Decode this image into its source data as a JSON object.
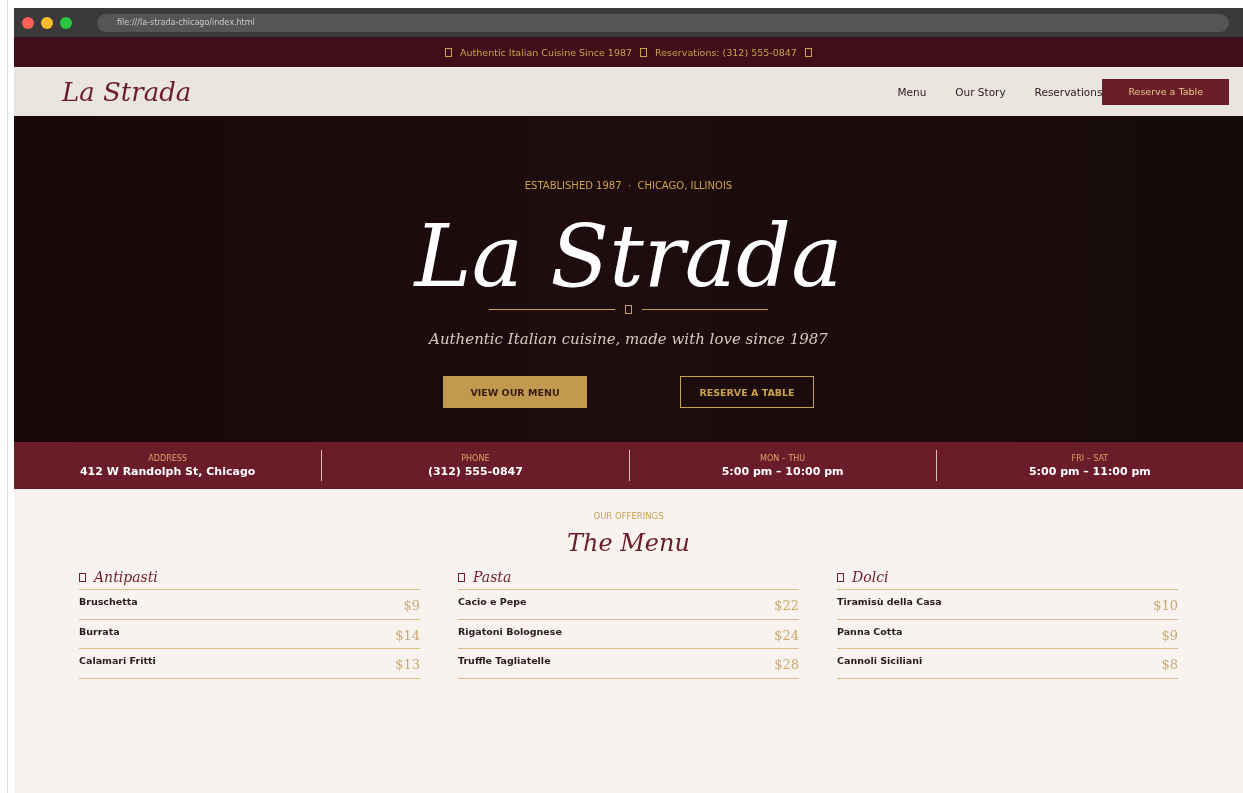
{
  "browser": {
    "url": "file:///la-strada-chicago/index.html"
  },
  "announcement": {
    "items": [
      "Authentic Italian Cuisine Since 1987",
      "Reservations: (312) 555-0847"
    ]
  },
  "nav": {
    "logo": "La Strada",
    "links": [
      "Menu",
      "Our Story",
      "Reservations"
    ],
    "cta": "Reserve a Table"
  },
  "hero": {
    "eyebrow": "ESTABLISHED 1987  ·  CHICAGO, ILLINOIS",
    "title": "La Strada",
    "tagline": "Authentic Italian cuisine, made with love since 1987",
    "buttons": [
      {
        "label": "VIEW OUR MENU",
        "kind": "primary"
      },
      {
        "label": "RESERVE A TABLE",
        "kind": "outline"
      }
    ]
  },
  "info": [
    {
      "label": "ADDRESS",
      "value": "412 W Randolph St, Chicago"
    },
    {
      "label": "PHONE",
      "value": "(312) 555-0847"
    },
    {
      "label": "MON – THU",
      "value": "5:00 pm – 10:00 pm"
    },
    {
      "label": "FRI – SAT",
      "value": "5:00 pm – 11:00 pm"
    }
  ],
  "menu": {
    "eyebrow": "OUR OFFERINGS",
    "title": "The Menu",
    "categories": [
      {
        "name": "Antipasti",
        "items": [
          {
            "name": "Bruschetta",
            "price": "$9"
          },
          {
            "name": "Burrata",
            "price": "$14"
          },
          {
            "name": "Calamari Fritti",
            "price": "$13"
          }
        ]
      },
      {
        "name": "Pasta",
        "items": [
          {
            "name": "Cacio e Pepe",
            "price": "$22"
          },
          {
            "name": "Rigatoni Bolognese",
            "price": "$24"
          },
          {
            "name": "Truffle Tagliatelle",
            "price": "$28"
          }
        ]
      },
      {
        "name": "Dolci",
        "items": [
          {
            "name": "Tiramisù della Casa",
            "price": "$10"
          },
          {
            "name": "Panna Cotta",
            "price": "$9"
          },
          {
            "name": "Cannoli Siciliani",
            "price": "$8"
          }
        ]
      }
    ]
  }
}
